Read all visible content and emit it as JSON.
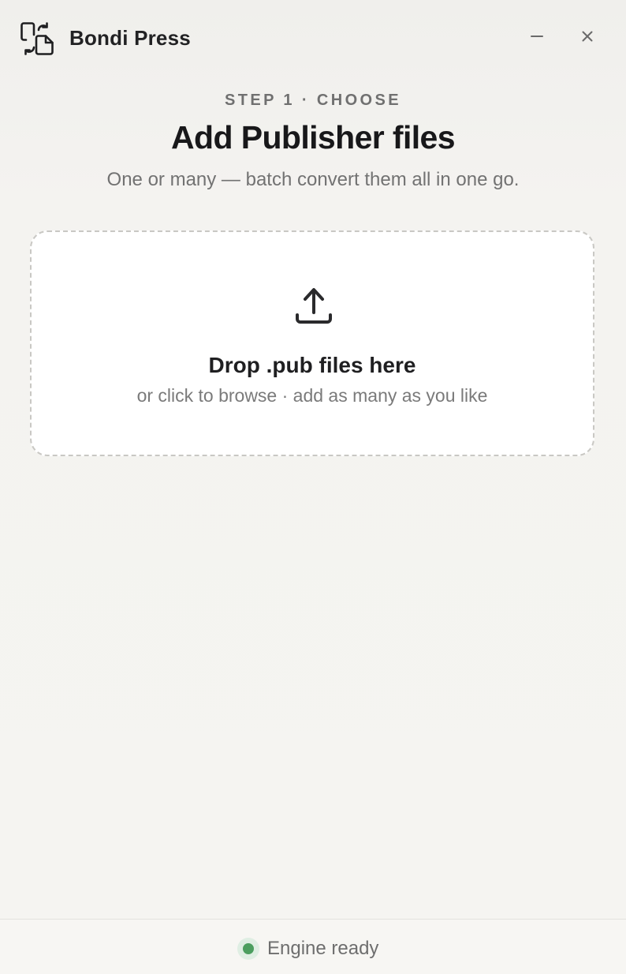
{
  "app": {
    "title": "Bondi Press",
    "icon": "convert-files-icon"
  },
  "window_controls": {
    "minimize_icon": "minimize-icon",
    "close_icon": "close-icon"
  },
  "header": {
    "step": "STEP 1 · CHOOSE",
    "title": "Add Publisher files",
    "subtitle": "One or many — batch convert them all in one go."
  },
  "dropzone": {
    "icon": "upload-icon",
    "title": "Drop .pub files here",
    "subtitle": "or click to browse · add as many as you like"
  },
  "status": {
    "text": "Engine ready",
    "color": "#4c9e5f"
  },
  "colors": {
    "background": "#f5f4f1",
    "surface": "#ffffff",
    "text_primary": "#18181a",
    "text_secondary": "#727272",
    "dashed_border": "#c9c8c4"
  }
}
